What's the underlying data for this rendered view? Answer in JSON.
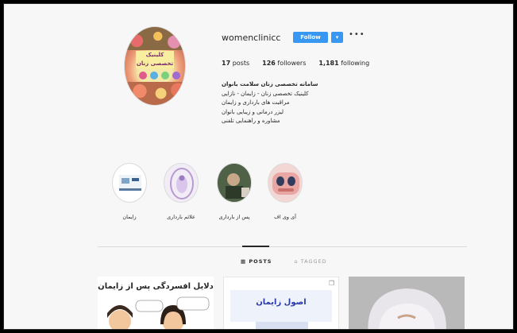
{
  "profile": {
    "username": "womenclinicc",
    "follow_label": "Follow",
    "dropdown_icon": "chevron-down-icon",
    "more_icon": "ellipsis-icon",
    "more_label": "•••",
    "avatar_text": "کلینیک تخصصی زنان"
  },
  "stats": {
    "posts": {
      "count": "17",
      "label": "posts"
    },
    "followers": {
      "count": "126",
      "label": "followers"
    },
    "following": {
      "count": "1,181",
      "label": "following"
    }
  },
  "bio": {
    "lines": [
      {
        "text": "سامانه تخصصی زنان سلامت بانوان",
        "bold": true
      },
      {
        "text": "کلینیک تخصصی زنان - زایمان - نازایی",
        "bold": false
      },
      {
        "text": "مراقبت های بارداری و زایمان",
        "bold": false
      },
      {
        "text": "لیزر درمانی و زیبایی بانوان",
        "bold": false
      },
      {
        "text": "مشاوره و راهنمایی تلفنی",
        "bold": false
      }
    ]
  },
  "highlights": [
    {
      "label": "زایمان",
      "icon": "clinic-icon"
    },
    {
      "label": "علائم بارداری",
      "icon": "pregnancy-icon"
    },
    {
      "label": "پس از بارداری",
      "icon": "photo-icon"
    },
    {
      "label": "آی وی اف",
      "icon": "face-icon"
    }
  ],
  "tabs": {
    "posts": "▦ POSTS",
    "tagged": "⌂ TAGGED"
  },
  "posts": [
    {
      "title": "دلایل افسردگی پس از زایمان"
    },
    {
      "title": "اصول زایمان"
    },
    {
      "title": ""
    }
  ],
  "colors": {
    "follow_button": "#3897f0",
    "background": "#f7f7f7"
  }
}
